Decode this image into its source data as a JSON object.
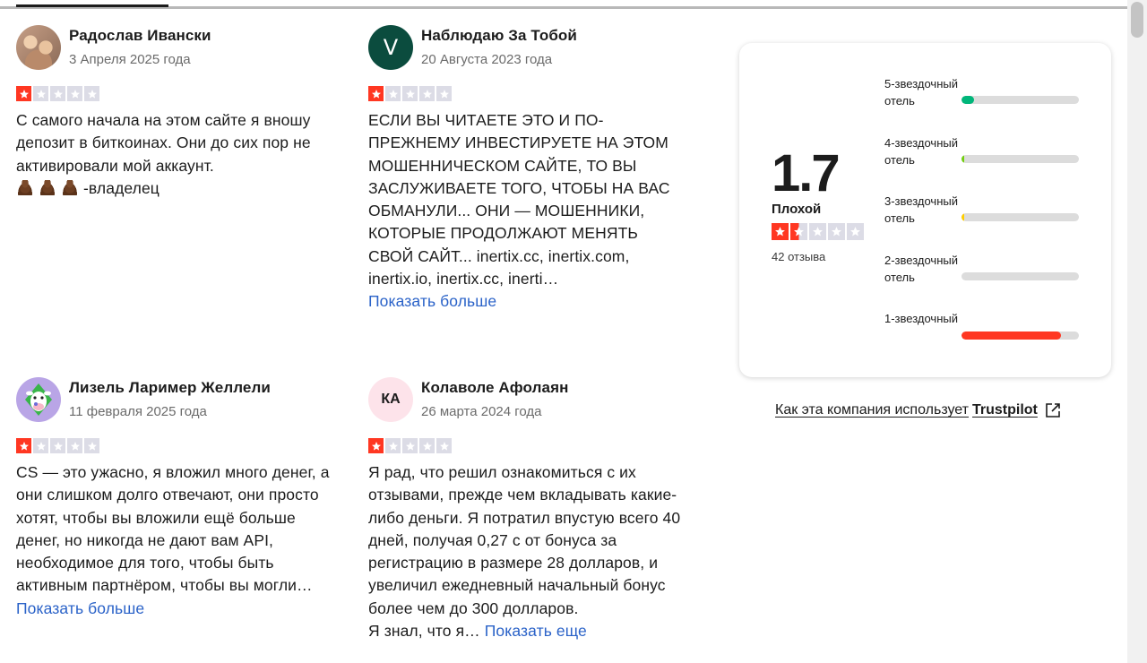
{
  "reviews": [
    {
      "name": "Радослав Ивански",
      "date": "3 Апреля 2025 года",
      "rating": 1,
      "body": "С самого начала на этом сайте я вношу депозит в биткоинах. Они до сих пор не активировали мой аккаунт.",
      "tail": "-владелец",
      "more": ""
    },
    {
      "name": "Наблюдаю За Тобой",
      "date": "20 Августа 2023 года",
      "avatar_letter": "V",
      "rating": 1,
      "body": "ЕСЛИ ВЫ ЧИТАЕТЕ ЭТО И ПО-ПРЕЖНЕМУ ИНВЕСТИРУЕТЕ НА ЭТОМ МОШЕННИЧЕСКОМ САЙТЕ, ТО ВЫ ЗАСЛУЖИВАЕТЕ ТОГО, ЧТОБЫ НА ВАС ОБМАНУЛИ... ОНИ — МОШЕННИКИ, КОТОРЫЕ ПРОДОЛЖАЮТ МЕНЯТЬ СВОЙ САЙТ... inertix.cc, inertix.com, inertix.io, inertix.cc, inerti…",
      "more": "Показать больше"
    },
    {
      "name": "Лизель Лаример Желлели",
      "date": "11 февраля 2025 года",
      "rating": 1,
      "body": "CS — это ужасно, я вложил много денег, а они слишком долго отвечают, они просто хотят, чтобы вы вложили ещё больше денег, но никогда не дают вам API, необходимое для того, чтобы быть активным партнёром, чтобы вы могли… ",
      "more": "Показать больше"
    },
    {
      "name": "Колаволе Афолаян",
      "date": "26 марта 2024 года",
      "avatar_letter": "КА",
      "rating": 1,
      "body": "Я рад, что решил ознакомиться с их отзывами, прежде чем вкладывать какие-либо деньги. Я потратил впустую всего 40 дней, получая 0,27 с от бонуса за регистрацию в размере 28 долларов, и увеличил ежедневный начальный бонус более чем до 300 долларов.",
      "body2": "Я знал, что я… ",
      "more": "Показать еще"
    }
  ],
  "summary": {
    "score": "1.7",
    "label": "Плохой",
    "rating_stars": 1.5,
    "count": "42 отзыва",
    "bars": [
      {
        "label": "5-звездочный отель",
        "fraction": 0.11,
        "color": "#00b67a"
      },
      {
        "label": "4-звездочный отель",
        "fraction": 0.02,
        "color": "#73cf11"
      },
      {
        "label": "3-звездочный отель",
        "fraction": 0.02,
        "color": "#ffce00"
      },
      {
        "label": "2-звездочный отель",
        "fraction": 0.0,
        "color": "#ff8622"
      },
      {
        "label": "1-звездочный",
        "fraction": 0.85,
        "color": "#ff3722"
      }
    ]
  },
  "footer_link": {
    "text": "Как эта компания использует",
    "brand": "Trustpilot"
  },
  "icons": {
    "star": "star-icon",
    "external": "external-link-icon",
    "poop": "pile-of-poo-icon"
  }
}
